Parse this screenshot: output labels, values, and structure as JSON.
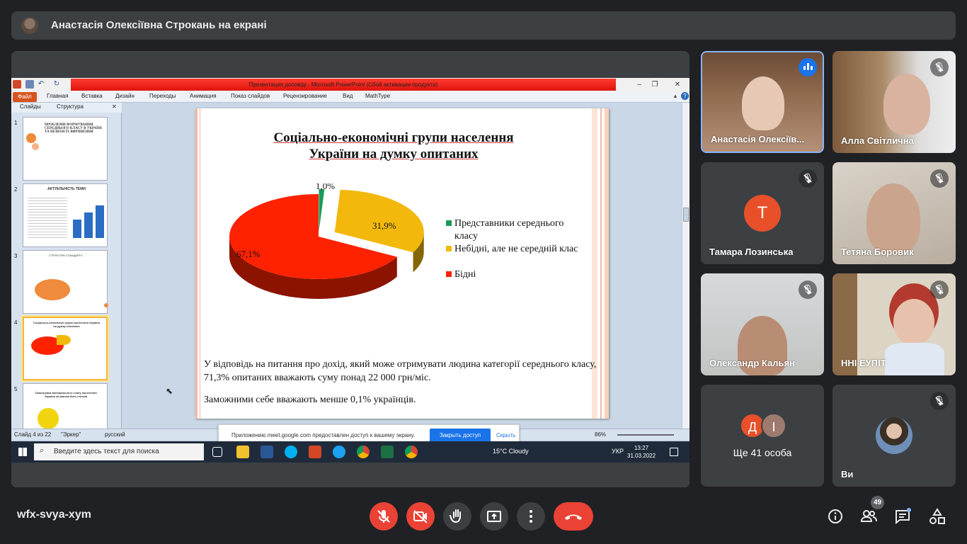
{
  "presenter_bar": {
    "title": "Анастасія Олексіївна Строкань на екрані"
  },
  "powerpoint": {
    "window_title": "Презентация доповіді  -  Microsoft PowerPoint (Сбой активации продукта)",
    "tabs": [
      "Файл",
      "Главная",
      "Вставка",
      "Дизайн",
      "Переходы",
      "Анимация",
      "Показ слайдов",
      "Рецензирование",
      "Вид",
      "MathType"
    ],
    "pane_tabs": [
      "Слайды",
      "Структура"
    ],
    "thumb_numbers": [
      "1",
      "2",
      "3",
      "4",
      "5"
    ],
    "thumb_titles": [
      "ПРОБЛЕМИ ФОРМУВАННЯ СЕРЕДНЬОГО КЛАСУ В УКРАЇНІ ТА ШЛЯХИ ЇХ ВИРІШЕННЯ",
      "АКТУАЛЬНІСТЬ ТЕМИ",
      "СТРУКТУРА СТАНДАРТУ ...",
      "Соціально-економічні групи населення України на думку опитаних",
      "Самооцінка матеріального стану населення України за рівнем його статків"
    ],
    "status": {
      "slide": "Слайд 4 из 22",
      "theme": "\"Эркер\"",
      "lang": "русский",
      "zoom": "86%"
    }
  },
  "slide": {
    "title_line1": "Соціально-економічні групи населення",
    "title_line2": "України на думку опитаних",
    "paragraph1": "У відповідь на питання про дохід, який може отримувати людина категорії середнього класу,  71,3% опитаних вважають суму  понад 22 000 грн/міс.",
    "paragraph2": "Заможними себе вважають менше 0,1% українців."
  },
  "chart_data": {
    "type": "pie",
    "categories": [
      "Представники середнього класу",
      "Небідні, але не середній клас",
      "Бідні"
    ],
    "values": [
      1.0,
      31.9,
      67.1
    ],
    "data_labels": [
      "1,0%",
      "31,9%",
      "67,1%"
    ],
    "colors": [
      "#1a9a5a",
      "#f2b90c",
      "#ff2200"
    ],
    "legend_position": "right",
    "exploded": true,
    "three_d": true
  },
  "share_notice": {
    "text": "Приложению meet.google.com предоставлен доступ к вашему экрану.",
    "stop_label": "Закрыть доступ",
    "hide_label": "Скрыть"
  },
  "taskbar": {
    "search_placeholder": "Введите здесь текст для поиска",
    "weather": "15°C  Cloudy",
    "lang": "УКР",
    "time": "13:27",
    "date": "31.03.2022"
  },
  "participants": [
    {
      "name": "Анастасія Олексіїв...",
      "speaking": true
    },
    {
      "name": "Алла Світлична",
      "muted": true
    },
    {
      "name": "Тамара Лозинська",
      "muted": true,
      "initial": "Т",
      "color": "#e8502a"
    },
    {
      "name": "Тетяна Боровик",
      "muted": true
    },
    {
      "name": "Олександр Кальян",
      "muted": true
    },
    {
      "name": "ННІ ЕУПІТ",
      "muted": true
    },
    {
      "name": "Ще 41 особа",
      "initials": [
        "Д",
        "І"
      ],
      "colors": [
        "#e8502a",
        "#9e7b6e"
      ]
    },
    {
      "name": "Ви",
      "muted": true
    }
  ],
  "bottom_bar": {
    "meeting_code": "wfx-svya-xym",
    "people_count": "49"
  },
  "icons": [
    "mic-off-icon",
    "camera-off-icon",
    "raise-hand-icon",
    "present-icon",
    "more-icon",
    "end-call-icon",
    "info-icon",
    "people-icon",
    "chat-icon",
    "activities-icon"
  ]
}
